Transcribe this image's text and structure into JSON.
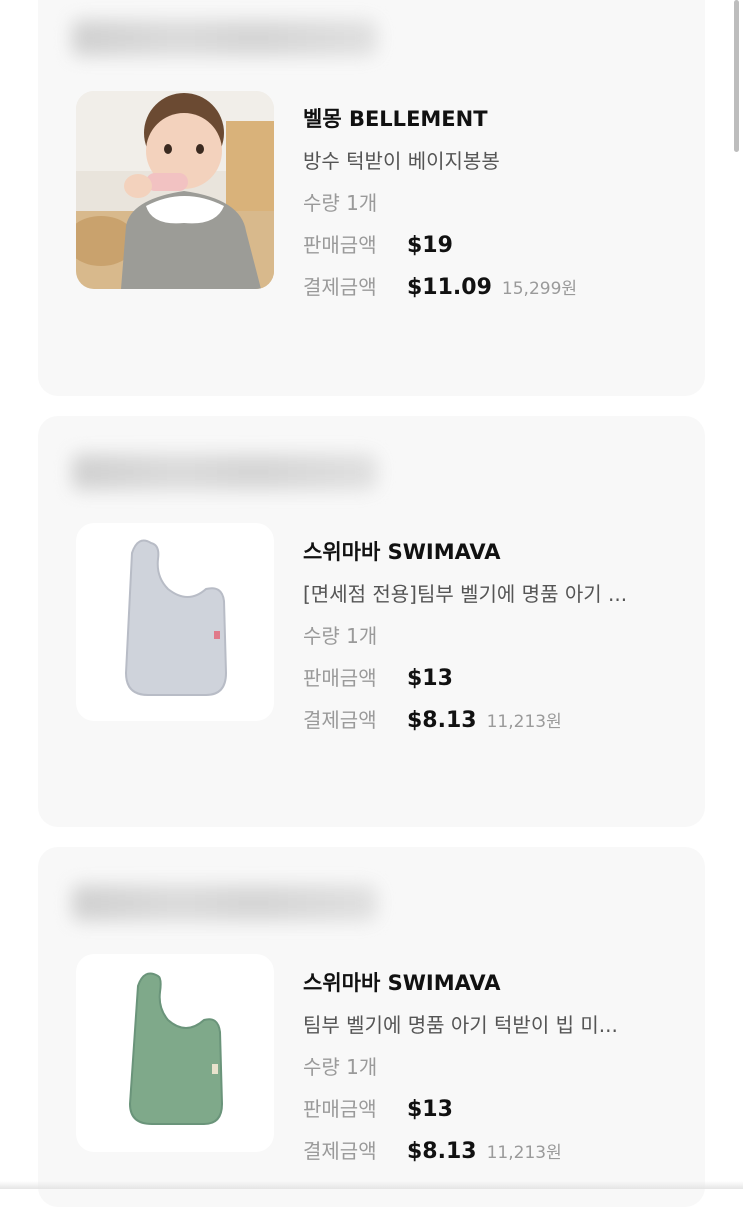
{
  "orders": [
    {
      "brand": "벨몽 BELLEMENT",
      "product": "방수 턱받이 베이지봉봉",
      "quantity": "수량 1개",
      "sale_label": "판매금액",
      "sale_price": "$19",
      "paid_label": "결제금액",
      "paid_price": "$11.09",
      "paid_krw": "15,299원"
    },
    {
      "brand": "스위마바 SWIMAVA",
      "product": "[면세점 전용]팀부 벨기에 명품 아기 ...",
      "quantity": "수량 1개",
      "sale_label": "판매금액",
      "sale_price": "$13",
      "paid_label": "결제금액",
      "paid_price": "$8.13",
      "paid_krw": "11,213원"
    },
    {
      "brand": "스위마바 SWIMAVA",
      "product": "팀부 벨기에 명품 아기 턱받이 빕 미...",
      "quantity": "수량 1개",
      "sale_label": "판매금액",
      "sale_price": "$13",
      "paid_label": "결제금액",
      "paid_price": "$8.13",
      "paid_krw": "11,213원"
    }
  ]
}
